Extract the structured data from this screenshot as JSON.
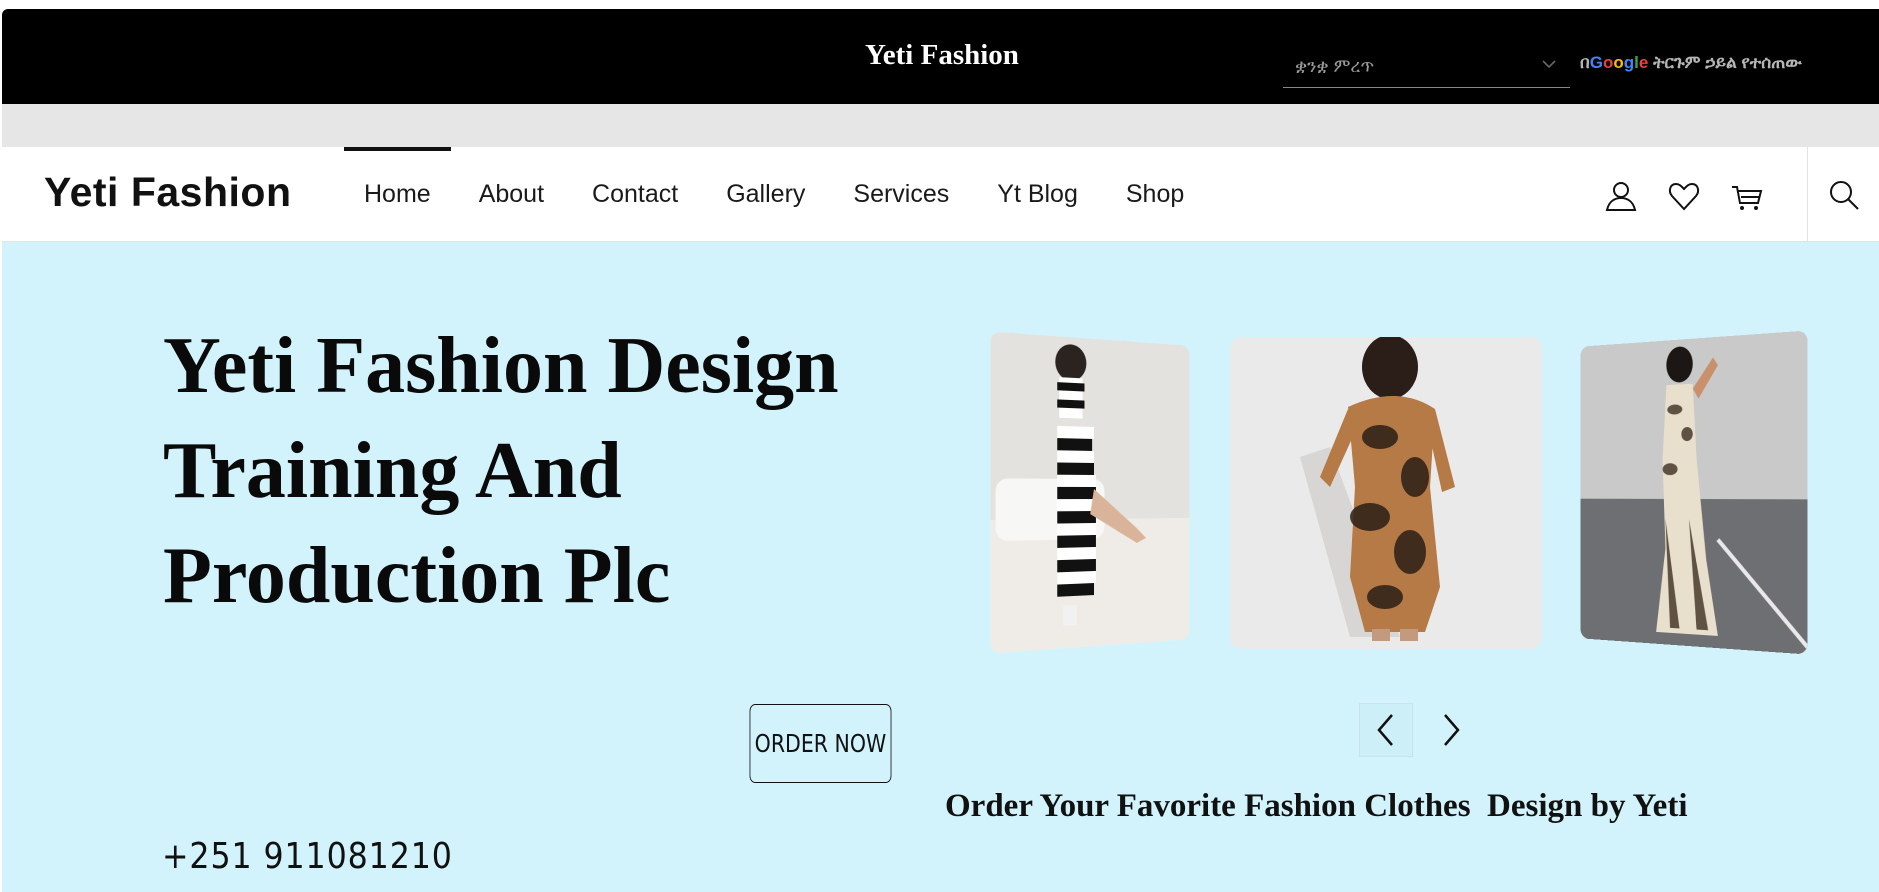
{
  "topbar": {
    "title": "Yeti Fashion",
    "language_select": {
      "placeholder": "ቋንቋ ምረጥ"
    },
    "translate_prefix": "በ",
    "google_logo": "Google",
    "translate_suffix": " ትርጉም ኃይል የተሰጠው"
  },
  "nav": {
    "brand": "Yeti Fashion",
    "items": [
      {
        "label": "Home",
        "active": true
      },
      {
        "label": "About"
      },
      {
        "label": "Contact"
      },
      {
        "label": "Gallery"
      },
      {
        "label": "Services"
      },
      {
        "label": "Yt Blog"
      },
      {
        "label": "Shop"
      }
    ],
    "icons": [
      "user-icon",
      "heart-icon",
      "cart-icon",
      "search-icon"
    ]
  },
  "hero": {
    "title": "Yeti Fashion Design Training And Production Plc",
    "order_button": "ORDER NOW",
    "phone": "+251 911081210",
    "tagline": "Order Your Favorite Fashion Clothes  Design by Yeti",
    "background_color": "#d3f3fc",
    "slides": [
      "striped-dress-photo",
      "tie-dye-dress-photo",
      "animal-print-dress-photo"
    ]
  }
}
